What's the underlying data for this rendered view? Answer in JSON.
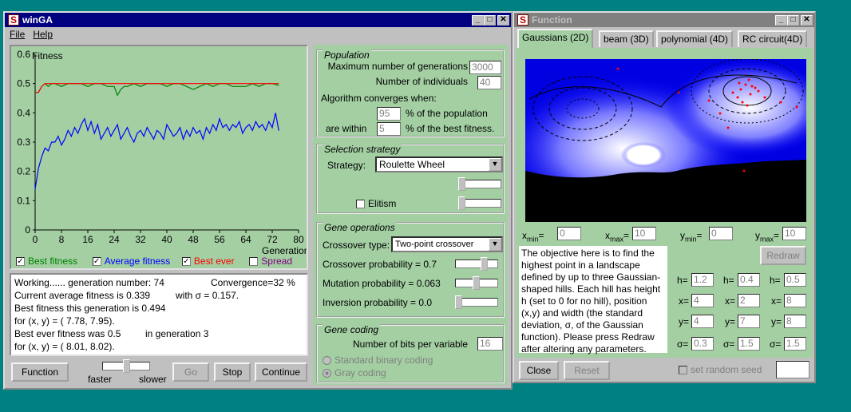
{
  "wingа": null,
  "winga": {
    "title": "winGA",
    "menu": [
      "File",
      "Help"
    ],
    "chart_data": {
      "type": "line",
      "xlabel": "Generation",
      "ylabel": "Fitness",
      "xlim": [
        0,
        80
      ],
      "ylim": [
        0,
        0.6
      ],
      "xticks": [
        "0",
        "8",
        "16",
        "24",
        "32",
        "40",
        "48",
        "56",
        "64",
        "72",
        "80"
      ],
      "yticks": [
        "0",
        "0.1",
        "0.2",
        "0.3",
        "0.4",
        "0.5",
        "0.6"
      ],
      "series": [
        {
          "name": "Best fitness",
          "color": "#008000",
          "x": [
            0,
            1,
            2,
            3,
            4,
            5,
            6,
            8,
            10,
            12,
            14,
            16,
            18,
            20,
            22,
            24,
            25,
            26,
            27,
            28,
            30,
            32,
            34,
            36,
            38,
            40,
            42,
            44,
            46,
            48,
            50,
            52,
            54,
            56,
            58,
            60,
            62,
            64,
            66,
            68,
            70,
            72,
            74
          ],
          "y": [
            0.47,
            0.47,
            0.49,
            0.5,
            0.49,
            0.5,
            0.5,
            0.49,
            0.5,
            0.5,
            0.5,
            0.49,
            0.5,
            0.5,
            0.49,
            0.49,
            0.46,
            0.48,
            0.49,
            0.49,
            0.5,
            0.49,
            0.5,
            0.5,
            0.5,
            0.49,
            0.5,
            0.5,
            0.49,
            0.48,
            0.49,
            0.5,
            0.49,
            0.5,
            0.5,
            0.49,
            0.49,
            0.49,
            0.5,
            0.49,
            0.5,
            0.5,
            0.494
          ]
        },
        {
          "name": "Average fitness",
          "color": "#0000ff",
          "x": [
            0,
            1,
            2,
            3,
            4,
            5,
            6,
            7,
            8,
            9,
            10,
            11,
            12,
            13,
            14,
            15,
            16,
            17,
            18,
            19,
            20,
            21,
            22,
            23,
            24,
            25,
            26,
            27,
            28,
            29,
            30,
            31,
            32,
            33,
            34,
            35,
            36,
            37,
            38,
            39,
            40,
            41,
            42,
            43,
            44,
            45,
            46,
            47,
            48,
            49,
            50,
            51,
            52,
            53,
            54,
            55,
            56,
            57,
            58,
            59,
            60,
            61,
            62,
            63,
            64,
            65,
            66,
            67,
            68,
            69,
            70,
            71,
            72,
            73,
            74
          ],
          "y": [
            0.14,
            0.21,
            0.25,
            0.28,
            0.27,
            0.3,
            0.3,
            0.32,
            0.29,
            0.31,
            0.34,
            0.32,
            0.35,
            0.33,
            0.36,
            0.38,
            0.34,
            0.37,
            0.33,
            0.36,
            0.31,
            0.33,
            0.35,
            0.32,
            0.34,
            0.36,
            0.31,
            0.33,
            0.35,
            0.32,
            0.3,
            0.33,
            0.34,
            0.32,
            0.35,
            0.33,
            0.31,
            0.34,
            0.33,
            0.31,
            0.36,
            0.34,
            0.32,
            0.33,
            0.35,
            0.31,
            0.34,
            0.32,
            0.35,
            0.33,
            0.34,
            0.31,
            0.35,
            0.33,
            0.36,
            0.34,
            0.38,
            0.35,
            0.36,
            0.34,
            0.36,
            0.35,
            0.37,
            0.33,
            0.35,
            0.36,
            0.34,
            0.37,
            0.35,
            0.36,
            0.34,
            0.37,
            0.35,
            0.4,
            0.339
          ]
        },
        {
          "name": "Best ever",
          "color": "#ff0000",
          "x": [
            0,
            1,
            2,
            3,
            4,
            74
          ],
          "y": [
            0.47,
            0.47,
            0.49,
            0.5,
            0.5,
            0.5
          ]
        }
      ]
    },
    "legend": {
      "best_fitness": "Best fitness",
      "average_fitness": "Average fitness",
      "best_ever": "Best ever",
      "spread": "Spread",
      "colors": {
        "best_fitness": "#008000",
        "average_fitness": "#0000ff",
        "best_ever": "#ff0000",
        "spread": "#800080"
      }
    },
    "status": {
      "line1a": "Working...... generation number: 74",
      "line1b": "Convergence=32 %",
      "line2a": "Current average fitness is  0.339",
      "line2b": "with σ = 0.157.",
      "line3": "Best fitness this generation is   0.494",
      "line4": " for (x, y) =  ( 7.78, 7.95).",
      "line5a": "Best ever fitness was   0.5",
      "line5b": "in generation   3",
      "line6": " for (x, y) =  ( 8.01, 8.02)."
    },
    "buttons": {
      "function": "Function",
      "go": "Go",
      "stop": "Stop",
      "continue": "Continue"
    },
    "speed": {
      "faster": "faster",
      "slower": "slower"
    },
    "population": {
      "title": "Population",
      "max_gen_label": "Maximum number of generations",
      "max_gen_value": "3000",
      "num_ind_label": "Number of individuals",
      "num_ind_value": "40",
      "converges_label": "Algorithm converges when:",
      "pop_value": "95",
      "pop_suffix": "% of the population",
      "within_label": "are within",
      "within_value": "5",
      "within_suffix": "% of the best fitness."
    },
    "selection": {
      "title": "Selection strategy",
      "strategy_label": "Strategy:",
      "strategy_value": "Roulette Wheel",
      "elitism": "Elitism"
    },
    "gene_ops": {
      "title": "Gene operations",
      "crossover_type_label": "Crossover type:",
      "crossover_type_value": "Two-point crossover",
      "crossover_prob": "Crossover probability = 0.7",
      "mutation_prob": "Mutation probability = 0.063",
      "inversion_prob": "Inversion probability = 0.0"
    },
    "gene_coding": {
      "title": "Gene coding",
      "bits_label": "Number of bits per variable",
      "bits_value": "16",
      "standard": "Standard binary coding",
      "gray": "Gray coding"
    }
  },
  "function_win": {
    "title": "Function",
    "tabs": [
      "Gaussians (2D)",
      "beam (3D)",
      "polynomial (4D)",
      "RC circuit(4D)"
    ],
    "ranges": {
      "xmin": "0",
      "xmax": "10",
      "ymin": "0",
      "ymax": "10"
    },
    "redraw": "Redraw",
    "description": "The objective here is to find the highest point in a landscape defined by up to three Gaussian-shaped hills. Each hill has height h (set to 0 for no hill), position (x,y) and width (the standard deviation, σ, of the Gaussian function). Please press Redraw after altering any parameters.",
    "hills": [
      {
        "h": "1.2",
        "x": "4",
        "y": "4",
        "s": "0.3"
      },
      {
        "h": "0.4",
        "x": "2",
        "y": "7",
        "s": "1.5"
      },
      {
        "h": "0.5",
        "x": "8",
        "y": "8",
        "s": "1.5"
      }
    ],
    "labels": {
      "h": "h=",
      "x": "x=",
      "y": "y=",
      "s": "σ="
    },
    "close": "Close",
    "reset": "Reset",
    "seed_label": "set random seed",
    "seed_value": ""
  }
}
